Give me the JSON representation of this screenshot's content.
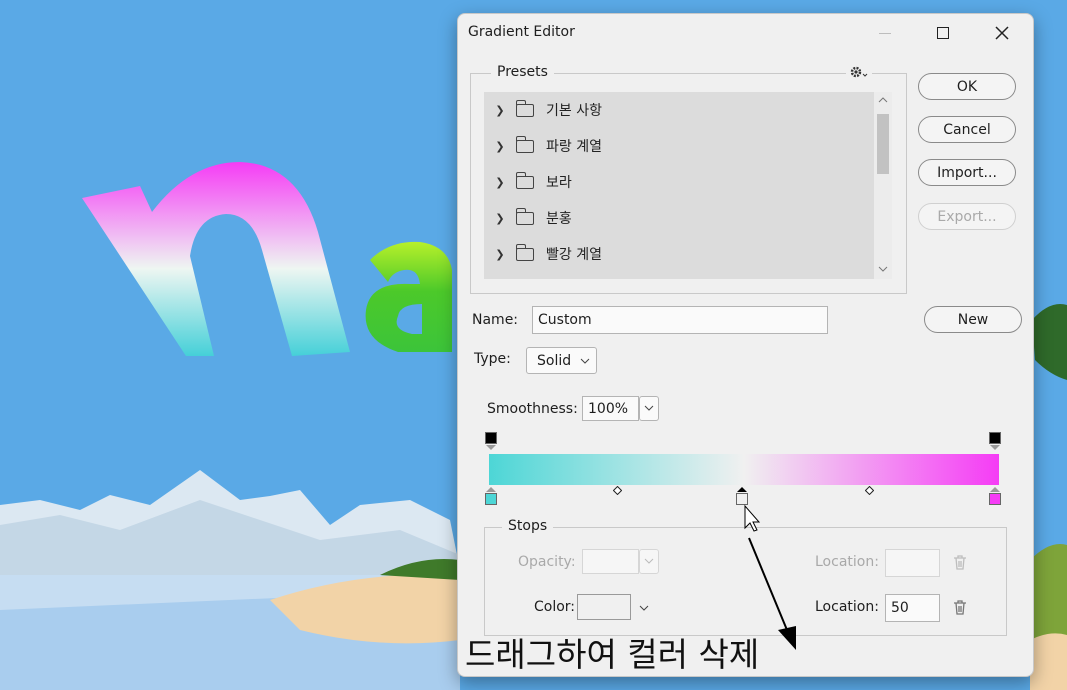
{
  "dialog": {
    "title": "Gradient Editor",
    "presets_label": "Presets",
    "preset_folders": [
      {
        "label": "기본 사항"
      },
      {
        "label": "파랑 계열"
      },
      {
        "label": "보라"
      },
      {
        "label": "분홍"
      },
      {
        "label": "빨강 계열"
      }
    ],
    "buttons": {
      "ok": "OK",
      "cancel": "Cancel",
      "import": "Import...",
      "export": "Export...",
      "new": "New"
    },
    "name_label": "Name:",
    "name_value": "Custom",
    "type_label": "Type:",
    "type_value": "Solid",
    "smoothness_label": "Smoothness:",
    "smoothness_value": "100%",
    "gradient": {
      "start_color": "#4dd6d6",
      "mid_color": "#f0f0f0",
      "end_color": "#f53cf5",
      "stop_positions_percent": [
        0,
        50,
        100
      ],
      "midpoint_positions_percent": [
        25,
        75
      ]
    },
    "stops": {
      "legend": "Stops",
      "opacity_label": "Opacity:",
      "opacity_location_label": "Location:",
      "color_label": "Color:",
      "color_location_label": "Location:",
      "color_location_value": "50"
    }
  },
  "canvas": {
    "letters": "na",
    "caption": "드래그하여 컬러 삭제"
  },
  "colors": {
    "sky": "#5aa9e6",
    "dialog_bg": "#f0f0f0",
    "list_bg": "#dcdcdc"
  }
}
